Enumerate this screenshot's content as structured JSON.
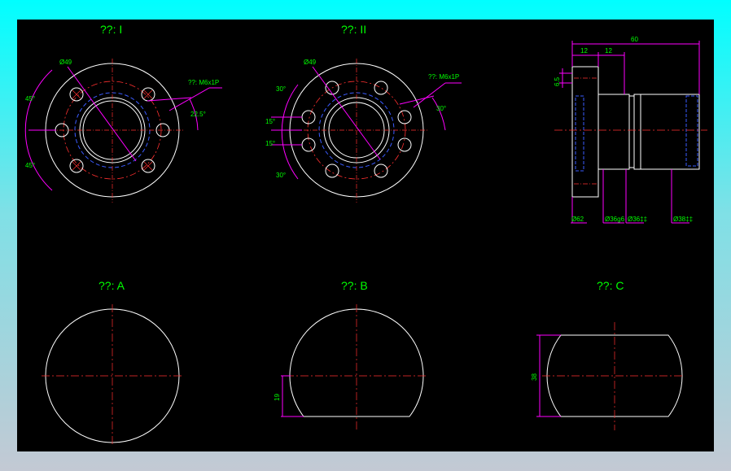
{
  "colors": {
    "outline": "#ffffff",
    "center_line": "#ff3030",
    "dimension": "#ff00ff",
    "text": "#00ff00",
    "hidden": "#3a5bff",
    "background": "#000000"
  },
  "views": {
    "view1": {
      "title": "??: I",
      "dia": "Ø49",
      "thread": "??: M6x1P",
      "angle_a": "45°",
      "angle_b": "45°",
      "angle_c": "22.5°"
    },
    "view2": {
      "title": "??: II",
      "dia": "Ø49",
      "thread": "??: M6x1P",
      "a30_top": "30°",
      "a15_1": "15°",
      "a15_2": "15°",
      "a30_bot": "30°",
      "a30_right": "30°"
    },
    "side": {
      "d60": "60",
      "d12a": "12",
      "d12b": "12",
      "d65": "6.5",
      "dia62": "Ø62",
      "dia36g6": "Ø36g6",
      "dia36h": "Ø36‡‡",
      "dia38": "Ø38‡‡"
    },
    "viewA": {
      "title": "??: A"
    },
    "viewB": {
      "title": "??: B",
      "dim19": "19"
    },
    "viewC": {
      "title": "??: C",
      "dim38": "38"
    }
  }
}
